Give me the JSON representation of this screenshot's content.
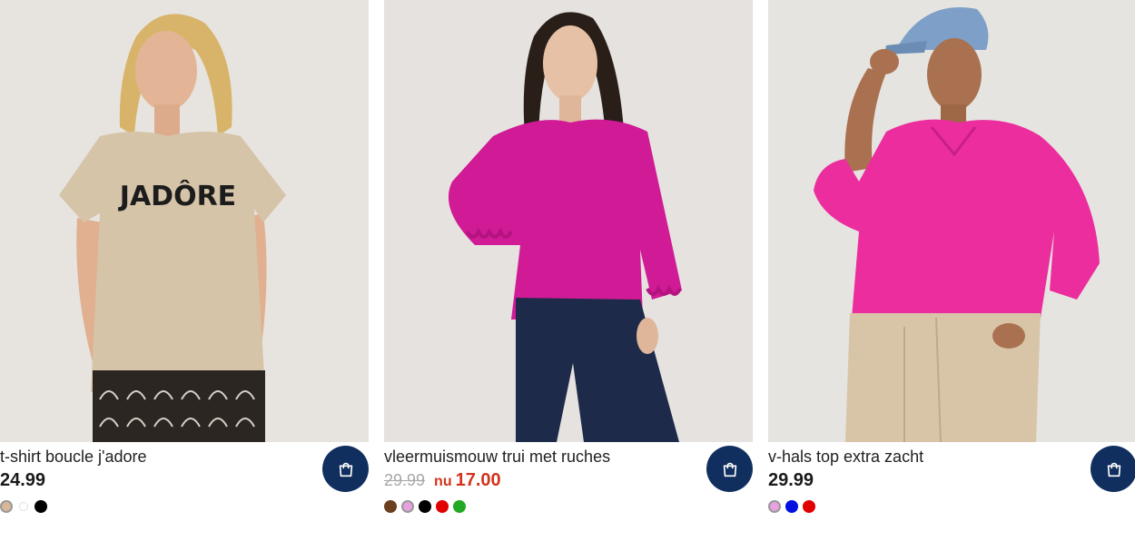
{
  "products": [
    {
      "title": "t-shirt boucle j'adore",
      "price": "24.99",
      "print_text": "JADÔRE",
      "colors": [
        {
          "name": "tan",
          "hex": "#d8b896",
          "selected": true
        },
        {
          "name": "white",
          "hex": "#ffffff",
          "selected": false
        },
        {
          "name": "black",
          "hex": "#000000",
          "selected": false
        }
      ]
    },
    {
      "title": "vleermuismouw trui met ruches",
      "old_price": "29.99",
      "sale_prefix": "nu",
      "sale_price": "17.00",
      "colors": [
        {
          "name": "brown",
          "hex": "#6b3e1e",
          "selected": false
        },
        {
          "name": "pink",
          "hex": "#e8a0e0",
          "selected": true
        },
        {
          "name": "black",
          "hex": "#000000",
          "selected": false
        },
        {
          "name": "red",
          "hex": "#e00000",
          "selected": false
        },
        {
          "name": "green",
          "hex": "#22a822",
          "selected": false
        }
      ]
    },
    {
      "title": "v-hals top extra zacht",
      "price": "29.99",
      "colors": [
        {
          "name": "pink",
          "hex": "#e8a0e0",
          "selected": true
        },
        {
          "name": "blue",
          "hex": "#0010e0",
          "selected": false
        },
        {
          "name": "red",
          "hex": "#e00000",
          "selected": false
        }
      ]
    }
  ],
  "icons": {
    "cart": "shopping-bag-icon"
  },
  "colors": {
    "cart_button": "#102f5e",
    "sale_red": "#d2341d"
  }
}
